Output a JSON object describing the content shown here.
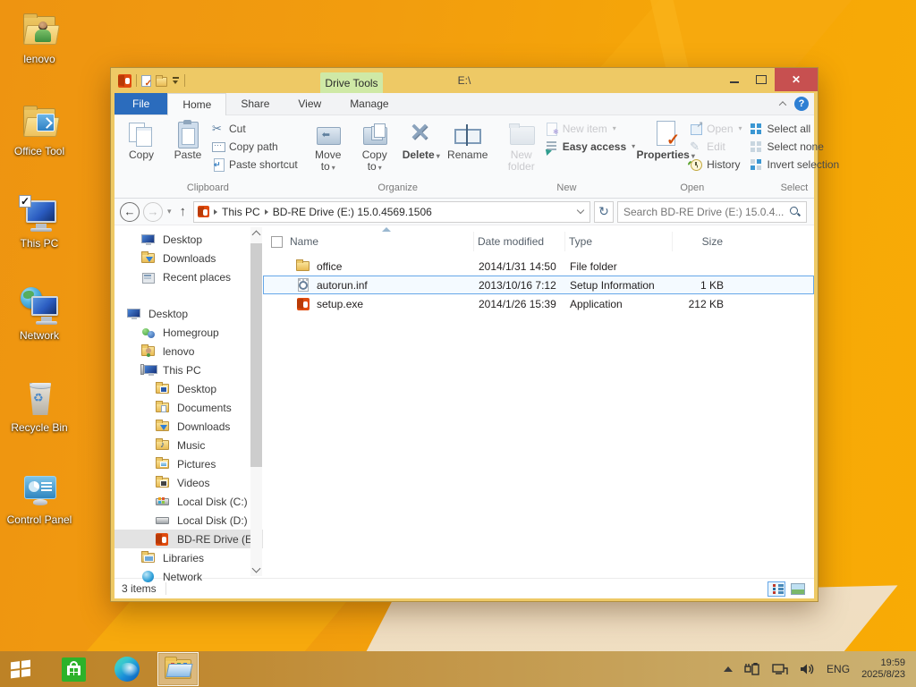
{
  "colors": {
    "accent_blue": "#2b6cbd",
    "drive_tools_green": "#cfe9a6",
    "close_red": "#c75050",
    "desktop_orange": "#f4a00c",
    "selection_border": "#66a7e8",
    "taskbar_tan": "#c49a4e"
  },
  "desktop": {
    "icons": [
      {
        "label": "lenovo"
      },
      {
        "label": "Office Tool"
      },
      {
        "label": "This PC"
      },
      {
        "label": "Network"
      },
      {
        "label": "Recycle Bin"
      },
      {
        "label": "Control Panel"
      }
    ]
  },
  "window": {
    "title": "E:\\",
    "drive_tools_label": "Drive Tools",
    "tabs": {
      "file": "File",
      "home": "Home",
      "share": "Share",
      "view": "View",
      "manage": "Manage"
    },
    "ribbon": {
      "clipboard": {
        "label": "Clipboard",
        "copy": "Copy",
        "paste": "Paste",
        "cut": "Cut",
        "copy_path": "Copy path",
        "paste_shortcut": "Paste shortcut"
      },
      "organize": {
        "label": "Organize",
        "move_line1": "Move",
        "move_line2": "to",
        "copy_line1": "Copy",
        "copy_line2": "to",
        "delete": "Delete",
        "rename": "Rename"
      },
      "new_group": {
        "label": "New",
        "new_folder_line1": "New",
        "new_folder_line2": "folder",
        "new_item": "New item",
        "easy_access": "Easy access"
      },
      "open_group": {
        "label": "Open",
        "properties": "Properties",
        "open": "Open",
        "edit": "Edit",
        "history": "History"
      },
      "select_group": {
        "label": "Select",
        "select_all": "Select all",
        "select_none": "Select none",
        "invert": "Invert selection"
      }
    },
    "address": {
      "crumb_root": "This PC",
      "crumb_drive": "BD-RE Drive (E:) 15.0.4569.1506"
    },
    "search": {
      "placeholder": "Search BD-RE Drive (E:) 15.0.4..."
    },
    "nav": {
      "items": [
        {
          "label": "Desktop"
        },
        {
          "label": "Downloads"
        },
        {
          "label": "Recent places"
        },
        {
          "label": "Desktop"
        },
        {
          "label": "Homegroup"
        },
        {
          "label": "lenovo"
        },
        {
          "label": "This PC"
        },
        {
          "label": "Desktop"
        },
        {
          "label": "Documents"
        },
        {
          "label": "Downloads"
        },
        {
          "label": "Music"
        },
        {
          "label": "Pictures"
        },
        {
          "label": "Videos"
        },
        {
          "label": "Local Disk (C:)"
        },
        {
          "label": "Local Disk (D:)"
        },
        {
          "label": "BD-RE Drive (E:"
        },
        {
          "label": "Libraries"
        },
        {
          "label": "Network"
        }
      ]
    },
    "files": {
      "columns": {
        "name": "Name",
        "date": "Date modified",
        "type": "Type",
        "size": "Size"
      },
      "rows": [
        {
          "name": "office",
          "date": "2014/1/31 14:50",
          "type": "File folder",
          "size": ""
        },
        {
          "name": "autorun.inf",
          "date": "2013/10/16 7:12",
          "type": "Setup Information",
          "size": "1 KB"
        },
        {
          "name": "setup.exe",
          "date": "2014/1/26 15:39",
          "type": "Application",
          "size": "212 KB"
        }
      ]
    },
    "status": {
      "items_count": "3 items"
    }
  },
  "taskbar": {
    "tray": {
      "language": "ENG",
      "time": "19:59",
      "date": "2025/8/23"
    }
  }
}
